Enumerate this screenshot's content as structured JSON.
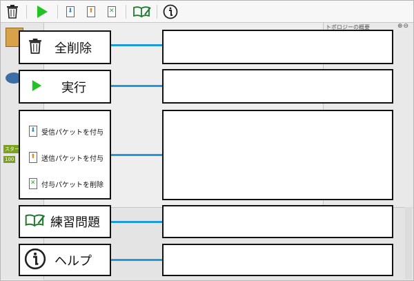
{
  "toolbar": {
    "icons": [
      "trash-icon",
      "play-icon",
      "receive-packet-icon",
      "send-packet-icon",
      "delete-packet-icon",
      "exercise-book-icon",
      "info-icon"
    ]
  },
  "background": {
    "right_panel_title": "トポロジーの概要",
    "zoom_controls": "⊕⊖",
    "start_badge": "スター",
    "number_badge": "100"
  },
  "callouts": {
    "delete_all": "全削除",
    "run": "実行",
    "receive_packet": "受信パケットを付与",
    "send_packet": "送信パケットを付与",
    "delete_packet": "付与パケットを削除",
    "exercises": "練習問題",
    "help": "ヘルプ"
  },
  "colors": {
    "accent_line": "#1e9ad6",
    "play_green": "#22c322",
    "book_green": "#1f7a30"
  }
}
